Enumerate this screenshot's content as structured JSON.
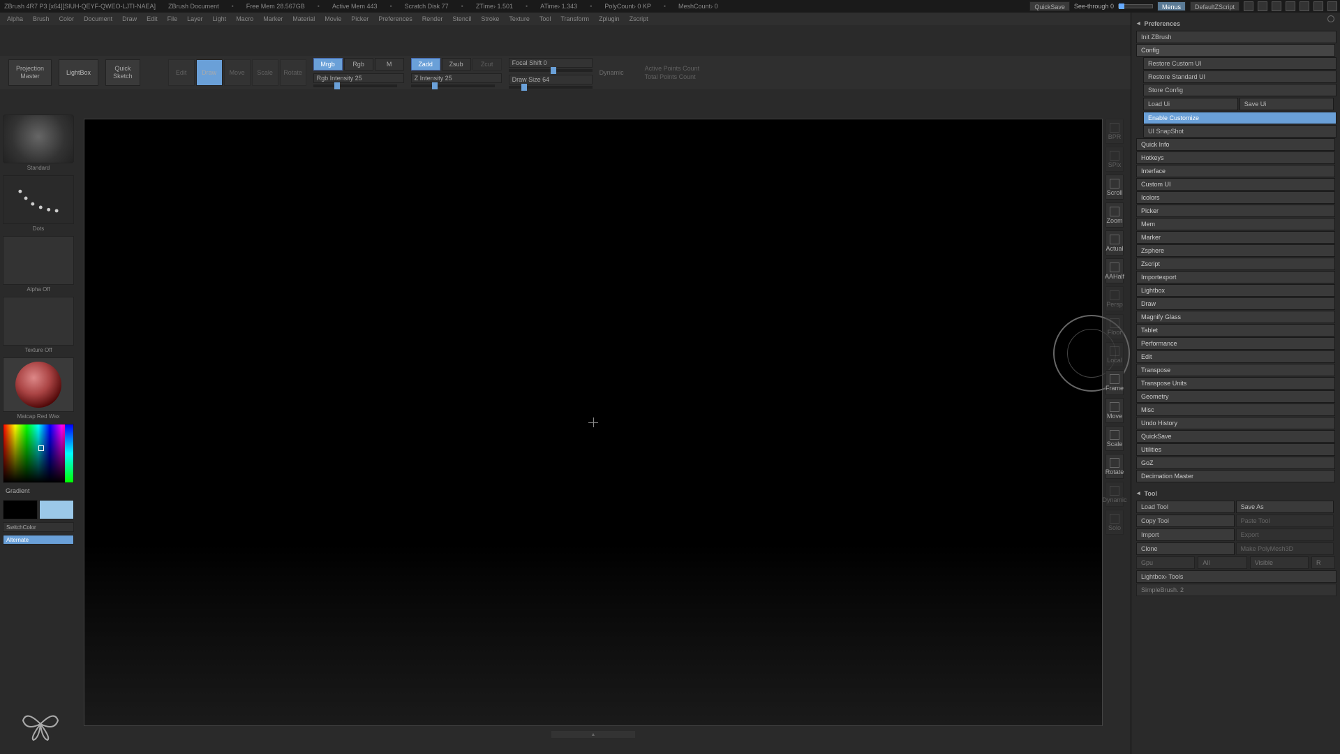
{
  "title": {
    "app": "ZBrush 4R7 P3 [x64][SIUH-QEYF-QWEO-LJTI-NAEA]",
    "doc": "ZBrush Document"
  },
  "stats": {
    "freemem": "Free Mem 28.567GB",
    "activemem": "Active Mem 443",
    "scratch": "Scratch Disk 77",
    "ztime": "ZTime› 1.501",
    "atime": "ATime› 1.343",
    "polycount": "PolyCount› 0 KP",
    "meshcount": "MeshCount› 0"
  },
  "topright": {
    "quicksave": "QuickSave",
    "seethrough": "See-through  0",
    "menus": "Menus",
    "script": "DefaultZScript"
  },
  "menus": [
    "Alpha",
    "Brush",
    "Color",
    "Document",
    "Draw",
    "Edit",
    "File",
    "Layer",
    "Light",
    "Macro",
    "Marker",
    "Material",
    "Movie",
    "Picker",
    "Preferences",
    "Render",
    "Stencil",
    "Stroke",
    "Texture",
    "Tool",
    "Transform",
    "Zplugin",
    "Zscript"
  ],
  "shelf": {
    "projection": "Projection\nMaster",
    "lightbox": "LightBox",
    "quicksketch": "Quick\nSketch",
    "edit": "Edit",
    "draw": "Draw",
    "move": "Move",
    "scale": "Scale",
    "rotate": "Rotate",
    "mrgb": "Mrgb",
    "rgb": "Rgb",
    "m": "M",
    "rgbint": "Rgb Intensity 25",
    "zadd": "Zadd",
    "zsub": "Zsub",
    "zcut": "Zcut",
    "zint": "Z Intensity 25",
    "focal": "Focal Shift 0",
    "drawsize": "Draw Size 64",
    "dynamic": "Dynamic",
    "activepts": "Active Points Count",
    "totalpts": "Total Points Count"
  },
  "lefttray": {
    "brush": "Standard",
    "stroke": "Dots",
    "alpha": "Alpha Off",
    "texture": "Texture Off",
    "material": "Matcap Red Wax",
    "gradient": "Gradient",
    "switchcolor": "SwitchColor",
    "alternate": "Alternate"
  },
  "righticons": [
    "BPR",
    "SPix",
    "Scroll",
    "Zoom",
    "Actual",
    "AAHalf",
    "Persp",
    "Floor",
    "Local",
    "Frame",
    "Move",
    "Scale",
    "Rotate",
    "Dynamic",
    "Solo"
  ],
  "prefs": {
    "title": "Preferences",
    "init": "Init ZBrush",
    "config": "Config",
    "restore_custom": "Restore Custom UI",
    "restore_standard": "Restore Standard UI",
    "store_config": "Store Config",
    "load_ui": "Load Ui",
    "save_ui": "Save Ui",
    "enable_customize": "Enable Customize",
    "ui_snapshot": "UI SnapShot",
    "sections": [
      "Quick Info",
      "Hotkeys",
      "Interface",
      "Custom UI",
      "Icolors",
      "Picker",
      "Mem",
      "Marker",
      "Zsphere",
      "Zscript",
      "Importexport",
      "Lightbox",
      "Draw",
      "Magnify Glass",
      "Tablet",
      "Performance",
      "Edit",
      "Transpose",
      "Transpose Units",
      "Geometry",
      "Misc",
      "Undo History",
      "QuickSave",
      "Utilities",
      "GoZ",
      "Decimation Master"
    ]
  },
  "tool": {
    "title": "Tool",
    "load": "Load Tool",
    "saveas": "Save As",
    "copy": "Copy Tool",
    "paste": "Paste Tool",
    "import": "Import",
    "export": "Export",
    "clone": "Clone",
    "makepoly": "Make PolyMesh3D",
    "all": "All",
    "visible": "Visible",
    "r": "R",
    "lightbox_tools": "Lightbox› Tools",
    "simplebrush": "SimpleBrush. 2"
  }
}
